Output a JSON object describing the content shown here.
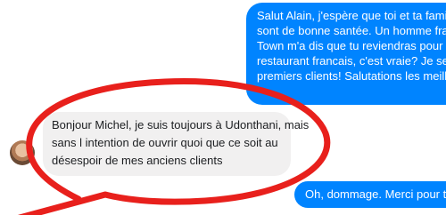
{
  "conversation": {
    "sent_message_1": {
      "lines": [
        "Salut Alain, j'espère que toi et ta fami",
        "sont de bonne santée. Un homme fra",
        "Town m'a dis que tu reviendras pour",
        "restaurant francais, c'est vraie? Je sera",
        "premiers clients! Salutations les meille"
      ]
    },
    "received_message": {
      "lines": [
        "Bonjour Michel, je suis toujours à Udonthani, mais",
        "sans l intention de ouvrir quoi que ce soit au",
        "désespoir de mes anciens clients"
      ]
    },
    "sent_message_2": {
      "text": "Oh, dommage. Merci pour t"
    }
  },
  "colors": {
    "sent_bubble": "#0084ff",
    "received_bubble": "#f1f0f0",
    "annotation": "#e8201c"
  },
  "icons": {
    "avatar": "contact-avatar"
  }
}
